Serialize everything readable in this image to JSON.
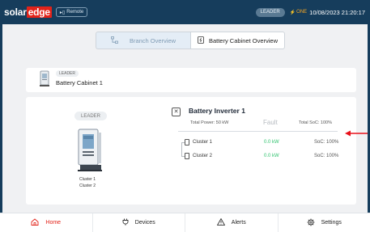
{
  "header": {
    "logo_part1": "solar",
    "logo_part2": "edge",
    "remote_label": "Remote",
    "leader_label": "LEADER",
    "one_label": "ONE",
    "datetime": "10/08/2023 21:20:17"
  },
  "tabs": [
    {
      "label": "Branch Overview",
      "active": true,
      "icon": "hierarchy-icon"
    },
    {
      "label": "Battery Cabinet Overview",
      "active": false,
      "icon": "battery-cabinet-icon"
    }
  ],
  "cabinet_card": {
    "badge": "LEADER",
    "name": "Battery Cabinet 1"
  },
  "detail_card": {
    "badge": "LEADER",
    "cluster_labels": [
      "Cluster 1",
      "Cluster 2"
    ],
    "inverter": {
      "title": "Battery Inverter 1",
      "total_power": "Total Power: 50 kW",
      "status": "Fault",
      "total_soc": "Total SoC: 100%"
    },
    "clusters": [
      {
        "name": "Cluster 1",
        "power": "0.0 kW",
        "soc": "SoC: 100%"
      },
      {
        "name": "Cluster 2",
        "power": "0.0 kW",
        "soc": "SoC: 100%"
      }
    ]
  },
  "nav": [
    {
      "label": "Home",
      "icon": "home-icon",
      "active": true
    },
    {
      "label": "Devices",
      "icon": "plug-icon",
      "active": false
    },
    {
      "label": "Alerts",
      "icon": "warning-icon",
      "active": false
    },
    {
      "label": "Settings",
      "icon": "gear-icon",
      "active": false
    }
  ],
  "colors": {
    "header_bg": "#163d5c",
    "accent_red": "#e2231a",
    "power_green": "#31c36f"
  }
}
